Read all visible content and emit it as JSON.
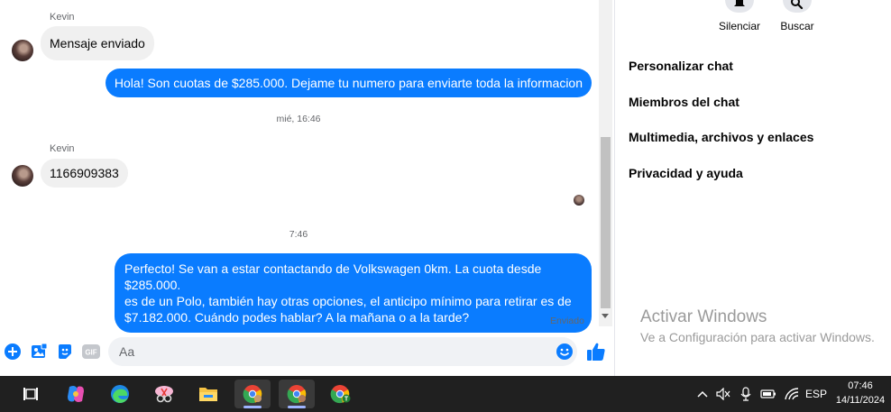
{
  "chat": {
    "msg1": {
      "sender": "Kevin",
      "text": "Mensaje enviado"
    },
    "msg2": {
      "text": "Hola! Son cuotas de $285.000. Dejame tu numero para enviarte toda la informacion"
    },
    "timestamp1": "mié, 16:46",
    "msg3": {
      "sender": "Kevin",
      "text": "1166909383"
    },
    "timestamp2": "7:46",
    "msg4": {
      "lines": [
        "Perfecto!  Se van a estar contactando de Volkswagen 0km. La cuota desde $285.000.",
        "es de un Polo, también hay otras opciones, el anticipo mínimo para retirar es de",
        "$7.182.000. Cuándo podes hablar? A la mañana o a la tarde?"
      ]
    },
    "status": "Enviado"
  },
  "composer": {
    "placeholder": "Aa",
    "gif_label": "GIF"
  },
  "panel": {
    "actions": [
      {
        "label": "Silenciar",
        "icon": "bell-icon"
      },
      {
        "label": "Buscar",
        "icon": "search-icon"
      }
    ],
    "menu": [
      "Personalizar chat",
      "Miembros del chat",
      "Multimedia, archivos y enlaces",
      "Privacidad y ayuda"
    ]
  },
  "watermark": {
    "title": "Activar Windows",
    "subtitle": "Ve a Configuración para activar Windows."
  },
  "taskbar": {
    "language": "ESP",
    "time": "07:46",
    "date": "14/11/2024",
    "chrome_badge": "T"
  },
  "colors": {
    "accent": "#0a7cff",
    "incoming": "#f0f0f0",
    "taskbar": "#202020"
  }
}
